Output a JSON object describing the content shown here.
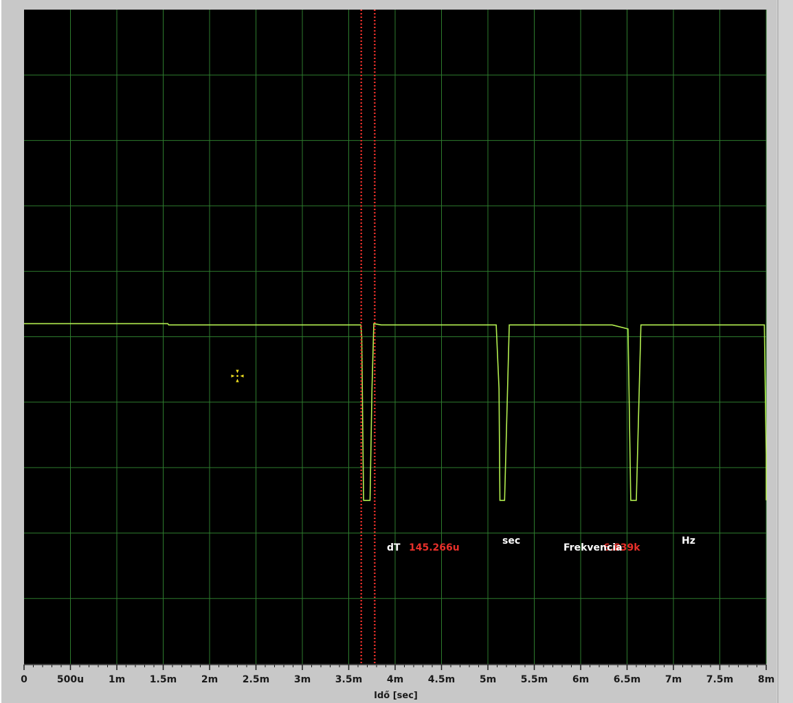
{
  "chart_data": {
    "type": "line",
    "xlabel": "Idő [sec]",
    "ylabel": "",
    "xlim": [
      0,
      0.008
    ],
    "ylim": [
      0,
      10
    ],
    "grid": true,
    "x_ticks": [
      {
        "value": 0,
        "label": "0"
      },
      {
        "value": 0.0005,
        "label": "500u"
      },
      {
        "value": 0.001,
        "label": "1m"
      },
      {
        "value": 0.0015,
        "label": "1.5m"
      },
      {
        "value": 0.002,
        "label": "2m"
      },
      {
        "value": 0.0025,
        "label": "2.5m"
      },
      {
        "value": 0.003,
        "label": "3m"
      },
      {
        "value": 0.0035,
        "label": "3.5m"
      },
      {
        "value": 0.004,
        "label": "4m"
      },
      {
        "value": 0.0045,
        "label": "4.5m"
      },
      {
        "value": 0.005,
        "label": "5m"
      },
      {
        "value": 0.0055,
        "label": "5.5m"
      },
      {
        "value": 0.006,
        "label": "6m"
      },
      {
        "value": 0.0065,
        "label": "6.5m"
      },
      {
        "value": 0.007,
        "label": "7m"
      },
      {
        "value": 0.0075,
        "label": "7.5m"
      },
      {
        "value": 0.008,
        "label": "8m"
      }
    ],
    "y_gridlines": 10,
    "series": [
      {
        "x": [
          0,
          0.00155,
          0.00156,
          0.00363,
          0.00364,
          0.00366,
          0.00373,
          0.00375,
          0.00377,
          0.00385,
          0.00509,
          0.00512,
          0.00513,
          0.00518,
          0.00523,
          0.00634,
          0.00651,
          0.00654,
          0.00655,
          0.0066,
          0.00665,
          0.00798,
          0.008,
          0.008
        ],
        "y": [
          5.2,
          5.2,
          5.18,
          5.18,
          5.0,
          2.5,
          2.5,
          4.2,
          5.2,
          5.18,
          5.18,
          4.2,
          2.5,
          2.5,
          5.18,
          5.18,
          5.12,
          2.5,
          2.5,
          2.5,
          5.18,
          5.18,
          3.2,
          2.5
        ]
      }
    ],
    "cursors": [
      0.003635,
      0.00378
    ],
    "marker_point": {
      "x": 0.0023,
      "y": 4.4
    }
  },
  "measurements": {
    "dt_label": "dT",
    "dt_value": "145.266u",
    "dt_unit": "sec",
    "freq_label": "Frekvencia",
    "freq_value": "6.839k",
    "freq_unit": "Hz"
  },
  "colors": {
    "plot_bg": "#000000",
    "frame_bg": "#c8c8c8",
    "grid": "#2e7d2e",
    "trace": "#b4f050",
    "cursor": "#e8302a",
    "marker": "#f0e020",
    "label_white": "#ffffff",
    "label_red": "#e8302a"
  }
}
